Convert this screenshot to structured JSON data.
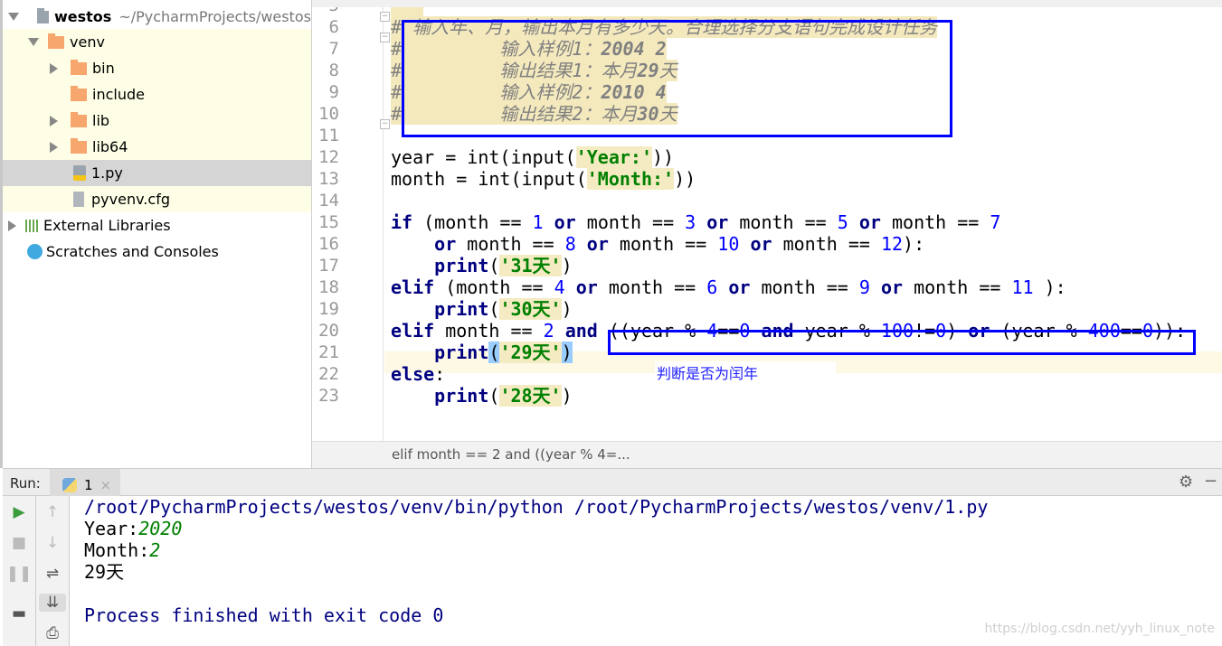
{
  "project_tree": {
    "root": {
      "name": "westos",
      "path": "~/PycharmProjects/westos"
    },
    "items": [
      {
        "label": "venv",
        "icon": "folder-icon"
      },
      {
        "label": "bin",
        "icon": "folder-icon"
      },
      {
        "label": "include",
        "icon": "folder-icon"
      },
      {
        "label": "lib",
        "icon": "folder-icon"
      },
      {
        "label": "lib64",
        "icon": "folder-link-icon"
      },
      {
        "label": "1.py",
        "icon": "python-file-icon"
      },
      {
        "label": "pyvenv.cfg",
        "icon": "text-file-icon"
      },
      {
        "label": "External Libraries",
        "icon": "library-icon"
      },
      {
        "label": "Scratches and Consoles",
        "icon": "scratches-icon"
      }
    ]
  },
  "editor": {
    "first_line": 5,
    "current_line": 21,
    "lines": [
      [
        [
          "\"\"\"",
          "com"
        ]
      ],
      [
        [
          "#",
          "hash"
        ],
        [
          " 输入年、月，输出本月有多少天。合理选择分支语句完成设计任务",
          "com"
        ]
      ],
      [
        [
          "#",
          "hash"
        ],
        [
          "         输入样例1：",
          "com"
        ],
        [
          "2004 2",
          "comb"
        ]
      ],
      [
        [
          "#",
          "hash"
        ],
        [
          "         输出结果1：本月",
          "com"
        ],
        [
          "29",
          "comb"
        ],
        [
          "天",
          "com"
        ]
      ],
      [
        [
          "#",
          "hash"
        ],
        [
          "         输入样例2：",
          "com"
        ],
        [
          "2010 4",
          "comb"
        ]
      ],
      [
        [
          "#",
          "hash"
        ],
        [
          "         输出结果2：本月",
          "com"
        ],
        [
          "30",
          "comb"
        ],
        [
          "天",
          "com"
        ]
      ],
      [],
      [
        [
          "year = int(input(",
          ""
        ],
        [
          "'Year:'",
          "str"
        ],
        [
          "))",
          ""
        ]
      ],
      [
        [
          "month = int(input(",
          ""
        ],
        [
          "'Month:'",
          "str"
        ],
        [
          "))",
          ""
        ]
      ],
      [],
      [
        [
          "if",
          "kw"
        ],
        [
          " (month == ",
          ""
        ],
        [
          "1",
          "num"
        ],
        [
          " ",
          ""
        ],
        [
          "or",
          "kw"
        ],
        [
          " month == ",
          ""
        ],
        [
          "3",
          "num"
        ],
        [
          " ",
          ""
        ],
        [
          "or",
          "kw"
        ],
        [
          " month == ",
          ""
        ],
        [
          "5",
          "num"
        ],
        [
          " ",
          ""
        ],
        [
          "or",
          "kw"
        ],
        [
          " month == ",
          ""
        ],
        [
          "7",
          "num"
        ]
      ],
      [
        [
          "    ",
          ""
        ],
        [
          "or",
          "kw"
        ],
        [
          " month == ",
          ""
        ],
        [
          "8",
          "num"
        ],
        [
          " ",
          ""
        ],
        [
          "or",
          "kw"
        ],
        [
          " month == ",
          ""
        ],
        [
          "10",
          "num"
        ],
        [
          " ",
          ""
        ],
        [
          "or",
          "kw"
        ],
        [
          " month == ",
          ""
        ],
        [
          "12",
          "num"
        ],
        [
          "):",
          ""
        ]
      ],
      [
        [
          "    ",
          ""
        ],
        [
          "print",
          "kw"
        ],
        [
          "(",
          ""
        ],
        [
          "'31天'",
          "str"
        ],
        [
          ")",
          ""
        ]
      ],
      [
        [
          "elif",
          "kw"
        ],
        [
          " (month == ",
          ""
        ],
        [
          "4",
          "num"
        ],
        [
          " ",
          ""
        ],
        [
          "or",
          "kw"
        ],
        [
          " month == ",
          ""
        ],
        [
          "6",
          "num"
        ],
        [
          " ",
          ""
        ],
        [
          "or",
          "kw"
        ],
        [
          " month == ",
          ""
        ],
        [
          "9",
          "num"
        ],
        [
          " ",
          ""
        ],
        [
          "or",
          "kw"
        ],
        [
          " month == ",
          ""
        ],
        [
          "11",
          "num"
        ],
        [
          " ):",
          ""
        ]
      ],
      [
        [
          "    ",
          ""
        ],
        [
          "print",
          "kw"
        ],
        [
          "(",
          ""
        ],
        [
          "'30天'",
          "str"
        ],
        [
          ")",
          ""
        ]
      ],
      [
        [
          "elif",
          "kw"
        ],
        [
          " month == ",
          ""
        ],
        [
          "2",
          "num"
        ],
        [
          " ",
          ""
        ],
        [
          "and",
          "kw"
        ],
        [
          " ((year % ",
          ""
        ],
        [
          "4",
          "num"
        ],
        [
          "==",
          ""
        ],
        [
          "0",
          "num"
        ],
        [
          " ",
          ""
        ],
        [
          "and",
          "kw"
        ],
        [
          " year % ",
          ""
        ],
        [
          "100",
          "num"
        ],
        [
          "!=",
          ""
        ],
        [
          "0",
          "num"
        ],
        [
          ") ",
          ""
        ],
        [
          "or",
          "kw"
        ],
        [
          " (year % ",
          ""
        ],
        [
          "400",
          "num"
        ],
        [
          "==",
          ""
        ],
        [
          "0",
          "num"
        ],
        [
          ")):",
          ""
        ]
      ],
      [
        [
          "    ",
          ""
        ],
        [
          "print",
          "kw"
        ],
        [
          "(",
          "brace"
        ],
        [
          "'29天'",
          "str"
        ],
        [
          ")",
          "brace"
        ]
      ],
      [
        [
          "else",
          "kw"
        ],
        [
          ":",
          ""
        ]
      ],
      [
        [
          "    ",
          ""
        ],
        [
          "print",
          "kw"
        ],
        [
          "(",
          ""
        ],
        [
          "'28天'",
          "str"
        ],
        [
          ")",
          ""
        ]
      ]
    ],
    "annotation": "判断是否为闰年",
    "breadcrumb": "elif month == 2 and ((year % 4=..."
  },
  "run": {
    "label": "Run:",
    "tab": "1",
    "output": [
      {
        "text": "/root/PycharmProjects/westos/venv/bin/python /root/PycharmProjects/westos/venv/1.py"
      },
      {
        "prompt": "Year:",
        "input": "2020"
      },
      {
        "prompt": "Month:",
        "input": "2"
      },
      {
        "text": "29天"
      },
      {
        "text": ""
      },
      {
        "text": "Process finished with exit code 0"
      }
    ]
  },
  "watermark": "https://blog.csdn.net/yyh_linux_note",
  "colors": {
    "keyword": "#000080",
    "number": "#0000ff",
    "string": "#008000",
    "highlight_box": "#0000ff"
  }
}
